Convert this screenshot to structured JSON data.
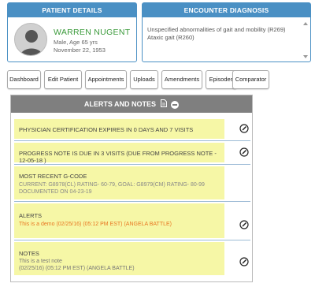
{
  "patient": {
    "header": "PATIENT DETAILS",
    "name": "WARREN NUGENT",
    "line1": "Male, Age 65 yrs",
    "line2": "November 22, 1953"
  },
  "encounter": {
    "header": "ENCOUNTER DIAGNOSIS",
    "line1": "Unspecified abnormalities of gait and mobility (R269)",
    "line2": "Ataxic gait (R260)"
  },
  "tabs": [
    "Dashboard",
    "Edit Patient",
    "Appointments",
    "Uploads",
    "Amendments",
    "Episodes",
    "Comparator"
  ],
  "alerts": {
    "header": "ALERTS AND NOTES",
    "physician_cert": "PHYSICIAN CERTIFICATION EXPIRES IN 0 DAYS AND 7 VISITS",
    "progress_note": "PROGRESS NOTE IS DUE IN 3 VISITS (DUE FROM PROGRESS NOTE - 12-05-18 )",
    "gcode": {
      "title": "MOST RECENT G-CODE",
      "line1": "CURRENT: G8978(CL) RATING- 60-79, GOAL: G8979(CM) RATING- 80-99",
      "line2": "DOCUMENTED ON 04-23-19"
    },
    "alerts_section": {
      "title": "ALERTS",
      "text": "This is a demo (02/25/16) (05:12 PM EST) (ANGELA BATTLE)"
    },
    "notes_section": {
      "title": "NOTES",
      "line1": "This is  a test note",
      "line2": "(02/25/16) (05:12 PM EST) (ANGELA BATTLE)"
    }
  },
  "colors": {
    "card_header": "#4a90c4",
    "patient_name": "#3a9a3a",
    "highlight": "#f6f7a6",
    "alert_text": "#e87722",
    "alerts_header": "#7f7f7f"
  },
  "icons": [
    "avatar",
    "document-icon",
    "collapse-minus-icon",
    "edit-circle-icon",
    "scroll-up-icon",
    "scroll-down-icon"
  ]
}
